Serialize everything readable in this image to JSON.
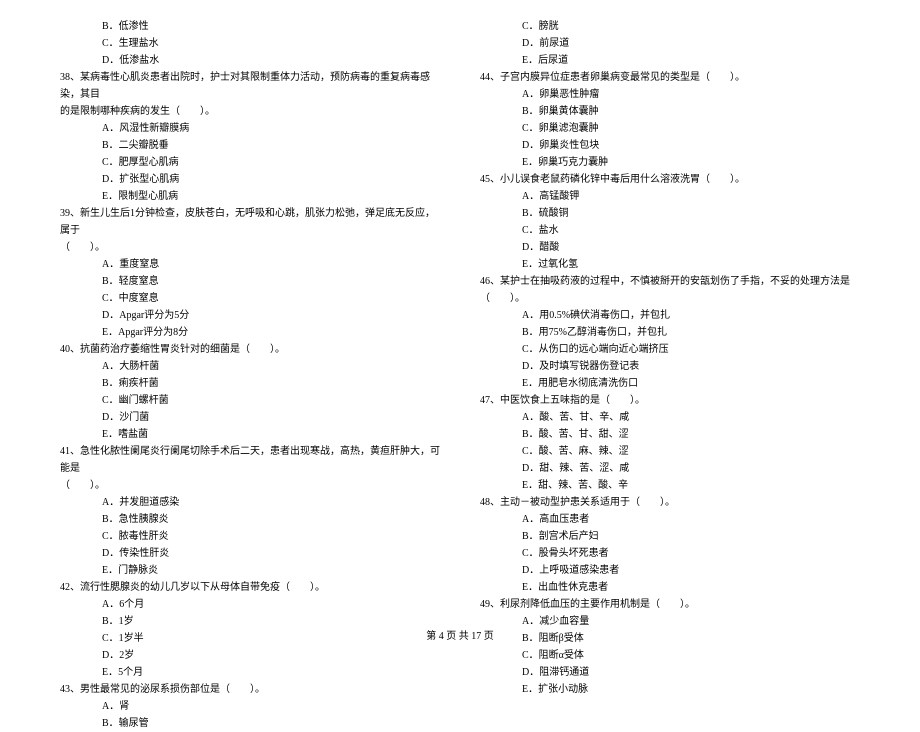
{
  "left": {
    "pre_options": {
      "b": "B．低渗性",
      "c": "C．生理盐水",
      "d": "D．低渗盐水"
    },
    "q38": {
      "line1": "38、某病毒性心肌炎患者出院时，护士对其限制重体力活动，预防病毒的重复病毒感染，其目",
      "line2": "的是限制哪种疾病的发生（　　）。",
      "a": "A．风湿性新瓣膜病",
      "b": "B．二尖瓣脱垂",
      "c": "C．肥厚型心肌病",
      "d": "D．扩张型心肌病",
      "e": "E．限制型心肌病"
    },
    "q39": {
      "line1": "39、新生儿生后1分钟检查，皮肤苍白，无呼吸和心跳，肌张力松弛，弹足底无反应，属于",
      "line2": "（　　）。",
      "a": "A．重度窒息",
      "b": "B．轻度窒息",
      "c": "C．中度窒息",
      "d": "D．Apgar评分为5分",
      "e": "E．Apgar评分为8分"
    },
    "q40": {
      "text": "40、抗菌药治疗萎缩性胃炎针对的细菌是（　　）。",
      "a": "A．大肠杆菌",
      "b": "B．痢疾杆菌",
      "c": "C．幽门螺杆菌",
      "d": "D．沙门菌",
      "e": "E．嗜盐菌"
    },
    "q41": {
      "line1": "41、急性化脓性阑尾炎行阑尾切除手术后二天，患者出现寒战，高热，黄疸肝肿大，可能是",
      "line2": "（　　）。",
      "a": "A．并发胆道感染",
      "b": "B．急性胰腺炎",
      "c": "C．脓毒性肝炎",
      "d": "D．传染性肝炎",
      "e": "E．门静脉炎"
    },
    "q42": {
      "text": "42、流行性腮腺炎的幼儿几岁以下从母体自带免疫（　　）。",
      "a": "A．6个月",
      "b": "B．1岁",
      "c": "C．1岁半",
      "d": "D．2岁",
      "e": "E．5个月"
    },
    "q43": {
      "text": "43、男性最常见的泌尿系损伤部位是（　　）。",
      "a": "A．肾",
      "b": "B．输尿管"
    }
  },
  "right": {
    "pre_options": {
      "c": "C．膀胱",
      "d": "D．前尿道",
      "e": "E．后尿道"
    },
    "q44": {
      "text": "44、子宫内膜异位症患者卵巢病变最常见的类型是（　　）。",
      "a": "A．卵巢恶性肿瘤",
      "b": "B．卵巢黄体囊肿",
      "c": "C．卵巢滤泡囊肿",
      "d": "D．卵巢炎性包块",
      "e": "E．卵巢巧克力囊肿"
    },
    "q45": {
      "text": "45、小儿误食老鼠药磷化锌中毒后用什么溶液洗胃（　　）。",
      "a": "A．高锰酸钾",
      "b": "B．硫酸铜",
      "c": "C．盐水",
      "d": "D．醋酸",
      "e": "E．过氧化氢"
    },
    "q46": {
      "text": "46、某护士在抽吸药液的过程中，不慎被掰开的安瓿划伤了手指，不妥的处理方法是（　　）。",
      "a": "A．用0.5%碘伏消毒伤口，并包扎",
      "b": "B．用75%乙醇消毒伤口，并包扎",
      "c": "C．从伤口的远心端向近心端挤压",
      "d": "D．及时填写锐器伤登记表",
      "e": "E．用肥皂水彻底清洗伤口"
    },
    "q47": {
      "text": "47、中医饮食上五味指的是（　　）。",
      "a": "A．酸、苦、甘、辛、咸",
      "b": "B．酸、苦、甘、甜、涩",
      "c": "C．酸、苦、麻、辣、涩",
      "d": "D．甜、辣、苦、涩、咸",
      "e": "E．甜、辣、苦、酸、辛"
    },
    "q48": {
      "text": "48、主动－被动型护患关系适用于（　　）。",
      "a": "A．高血压患者",
      "b": "B．剖宫术后产妇",
      "c": "C．股骨头坏死患者",
      "d": "D．上呼吸道感染患者",
      "e": "E．出血性休克患者"
    },
    "q49": {
      "text": "49、利尿剂降低血压的主要作用机制是（　　）。",
      "a": "A．减少血容量",
      "b": "B．阻断β受体",
      "c": "C．阻断α受体",
      "d": "D．阻滞钙通道",
      "e": "E．扩张小动脉"
    }
  },
  "footer": "第 4 页 共 17 页"
}
